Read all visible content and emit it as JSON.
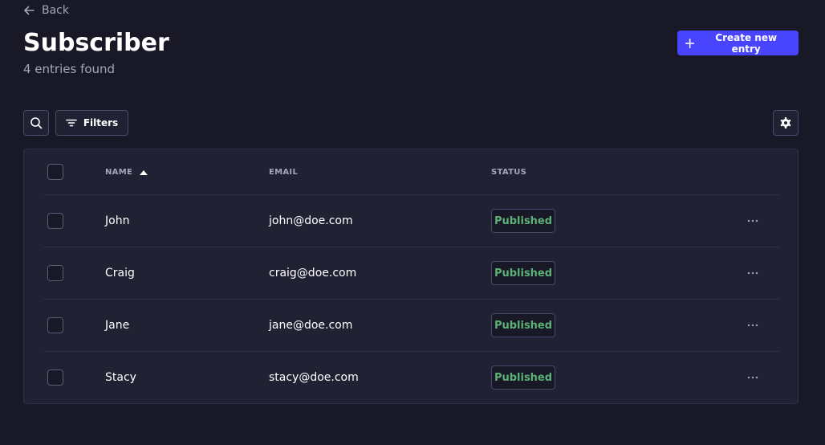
{
  "nav": {
    "back_label": "Back"
  },
  "header": {
    "title": "Subscriber",
    "subtitle": "4 entries found",
    "create_label": "Create new entry"
  },
  "toolbar": {
    "filters_label": "Filters"
  },
  "table": {
    "columns": {
      "name": "NAME",
      "email": "EMAIL",
      "status": "STATUS"
    },
    "sort": {
      "column": "NAME",
      "direction": "ascending"
    },
    "rows": [
      {
        "name": "John",
        "email": "john@doe.com",
        "status": "Published"
      },
      {
        "name": "Craig",
        "email": "craig@doe.com",
        "status": "Published"
      },
      {
        "name": "Jane",
        "email": "jane@doe.com",
        "status": "Published"
      },
      {
        "name": "Stacy",
        "email": "stacy@doe.com",
        "status": "Published"
      }
    ]
  },
  "icons": {
    "back": "arrow-left-icon",
    "create": "plus-icon",
    "search": "search-icon",
    "filters": "filter-icon",
    "settings": "gear-icon",
    "sort": "caret-up-icon",
    "more": "more-horizontal-icon"
  },
  "colors": {
    "background": "#181826",
    "surface": "#212134",
    "primary": "#4945ff",
    "published": "#5cb176",
    "muted_text": "#a5a5ba"
  }
}
